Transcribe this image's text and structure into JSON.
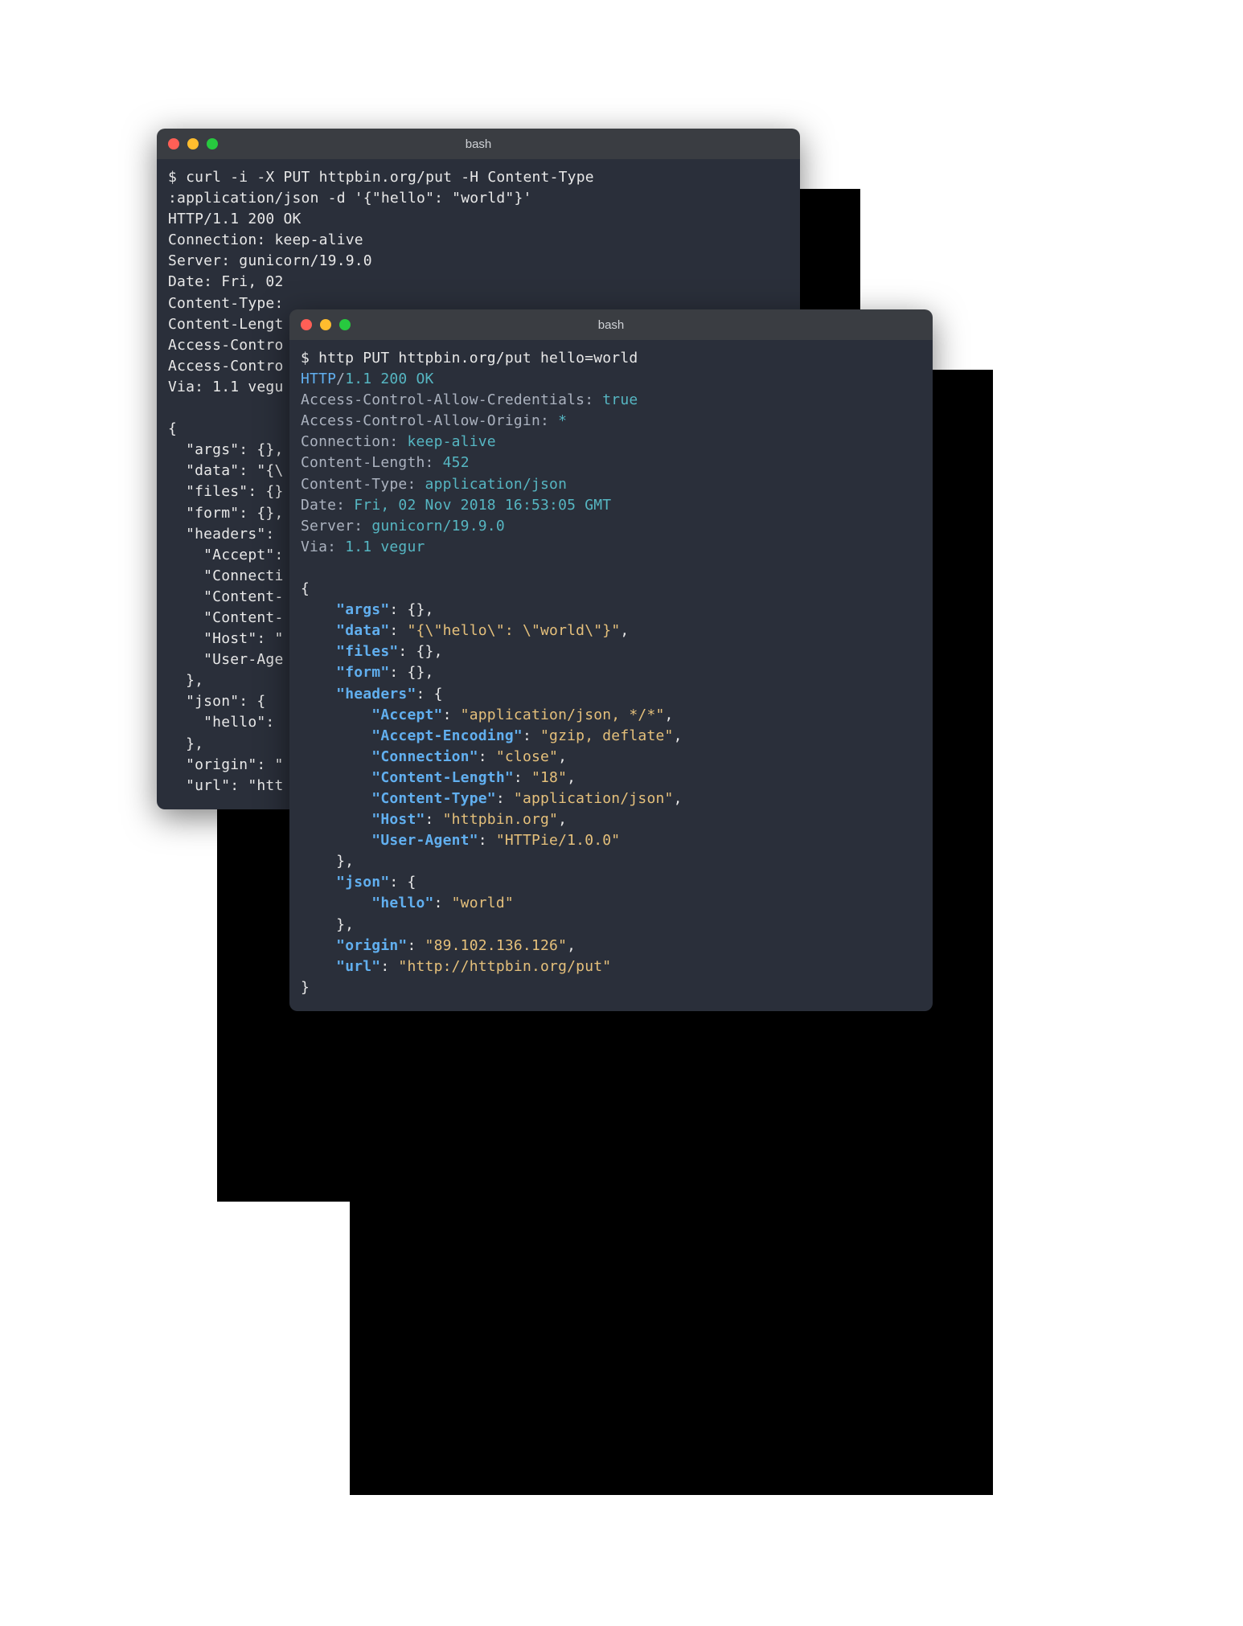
{
  "terminal1": {
    "title": "bash",
    "lines": [
      [
        {
          "t": "$ curl -i -X PUT httpbin.org/put -H Content-Type",
          "c": "c-white"
        }
      ],
      [
        {
          "t": ":application/json -d '{\"hello\": \"world\"}'",
          "c": "c-white"
        }
      ],
      [
        {
          "t": "HTTP/1.1 200 OK",
          "c": "c-white"
        }
      ],
      [
        {
          "t": "Connection: keep-alive",
          "c": "c-white"
        }
      ],
      [
        {
          "t": "Server: gunicorn/19.9.0",
          "c": "c-white"
        }
      ],
      [
        {
          "t": "Date: Fri, 02 ",
          "c": "c-white"
        }
      ],
      [
        {
          "t": "Content-Type: ",
          "c": "c-white"
        }
      ],
      [
        {
          "t": "Content-Lengt",
          "c": "c-white"
        }
      ],
      [
        {
          "t": "Access-Contro",
          "c": "c-white"
        }
      ],
      [
        {
          "t": "Access-Contro",
          "c": "c-white"
        }
      ],
      [
        {
          "t": "Via: 1.1 vegu",
          "c": "c-white"
        }
      ],
      [
        {
          "t": "",
          "c": "c-white"
        }
      ],
      [
        {
          "t": "{",
          "c": "c-white"
        }
      ],
      [
        {
          "t": "  \"args\": {},",
          "c": "c-white"
        }
      ],
      [
        {
          "t": "  \"data\": \"{\\",
          "c": "c-white"
        }
      ],
      [
        {
          "t": "  \"files\": {}",
          "c": "c-white"
        }
      ],
      [
        {
          "t": "  \"form\": {},",
          "c": "c-white"
        }
      ],
      [
        {
          "t": "  \"headers\": ",
          "c": "c-white"
        }
      ],
      [
        {
          "t": "    \"Accept\":",
          "c": "c-white"
        }
      ],
      [
        {
          "t": "    \"Connecti",
          "c": "c-white"
        }
      ],
      [
        {
          "t": "    \"Content-",
          "c": "c-white"
        }
      ],
      [
        {
          "t": "    \"Content-",
          "c": "c-white"
        }
      ],
      [
        {
          "t": "    \"Host\": \"",
          "c": "c-white"
        }
      ],
      [
        {
          "t": "    \"User-Age",
          "c": "c-white"
        }
      ],
      [
        {
          "t": "  },",
          "c": "c-white"
        }
      ],
      [
        {
          "t": "  \"json\": {",
          "c": "c-white"
        }
      ],
      [
        {
          "t": "    \"hello\": ",
          "c": "c-white"
        }
      ],
      [
        {
          "t": "  },",
          "c": "c-white"
        }
      ],
      [
        {
          "t": "  \"origin\": \"",
          "c": "c-white"
        }
      ],
      [
        {
          "t": "  \"url\": \"htt",
          "c": "c-white"
        }
      ]
    ]
  },
  "terminal2": {
    "title": "bash",
    "lines": [
      [
        {
          "t": "$ http PUT httpbin.org/put hello=world",
          "c": "c-white"
        }
      ],
      [
        {
          "t": "HTTP",
          "c": "c-blue"
        },
        {
          "t": "/",
          "c": "c-gray"
        },
        {
          "t": "1.1 200 OK",
          "c": "c-cyan"
        }
      ],
      [
        {
          "t": "Access-Control-Allow-Credentials",
          "c": "c-gray"
        },
        {
          "t": ":",
          "c": "c-gray"
        },
        {
          "t": " true",
          "c": "c-cyan"
        }
      ],
      [
        {
          "t": "Access-Control-Allow-Origin",
          "c": "c-gray"
        },
        {
          "t": ":",
          "c": "c-gray"
        },
        {
          "t": " *",
          "c": "c-cyan"
        }
      ],
      [
        {
          "t": "Connection",
          "c": "c-gray"
        },
        {
          "t": ":",
          "c": "c-gray"
        },
        {
          "t": " keep-alive",
          "c": "c-cyan"
        }
      ],
      [
        {
          "t": "Content-Length",
          "c": "c-gray"
        },
        {
          "t": ":",
          "c": "c-gray"
        },
        {
          "t": " 452",
          "c": "c-cyan"
        }
      ],
      [
        {
          "t": "Content-Type",
          "c": "c-gray"
        },
        {
          "t": ":",
          "c": "c-gray"
        },
        {
          "t": " application/json",
          "c": "c-cyan"
        }
      ],
      [
        {
          "t": "Date",
          "c": "c-gray"
        },
        {
          "t": ":",
          "c": "c-gray"
        },
        {
          "t": " Fri, 02 Nov 2018 16:53:05 GMT",
          "c": "c-cyan"
        }
      ],
      [
        {
          "t": "Server",
          "c": "c-gray"
        },
        {
          "t": ":",
          "c": "c-gray"
        },
        {
          "t": " gunicorn/19.9.0",
          "c": "c-cyan"
        }
      ],
      [
        {
          "t": "Via",
          "c": "c-gray"
        },
        {
          "t": ":",
          "c": "c-gray"
        },
        {
          "t": " 1.1 vegur",
          "c": "c-cyan"
        }
      ],
      [
        {
          "t": "",
          "c": "c-white"
        }
      ],
      [
        {
          "t": "{",
          "c": "c-white"
        }
      ],
      [
        {
          "t": "    ",
          "c": "c-white"
        },
        {
          "t": "\"args\"",
          "c": "c-blue bold"
        },
        {
          "t": ": ",
          "c": "c-white"
        },
        {
          "t": "{}",
          "c": "c-white"
        },
        {
          "t": ",",
          "c": "c-white"
        }
      ],
      [
        {
          "t": "    ",
          "c": "c-white"
        },
        {
          "t": "\"data\"",
          "c": "c-blue bold"
        },
        {
          "t": ": ",
          "c": "c-white"
        },
        {
          "t": "\"{\\\"hello\\\": \\\"world\\\"}\"",
          "c": "c-yellow"
        },
        {
          "t": ",",
          "c": "c-white"
        }
      ],
      [
        {
          "t": "    ",
          "c": "c-white"
        },
        {
          "t": "\"files\"",
          "c": "c-blue bold"
        },
        {
          "t": ": ",
          "c": "c-white"
        },
        {
          "t": "{}",
          "c": "c-white"
        },
        {
          "t": ",",
          "c": "c-white"
        }
      ],
      [
        {
          "t": "    ",
          "c": "c-white"
        },
        {
          "t": "\"form\"",
          "c": "c-blue bold"
        },
        {
          "t": ": ",
          "c": "c-white"
        },
        {
          "t": "{}",
          "c": "c-white"
        },
        {
          "t": ",",
          "c": "c-white"
        }
      ],
      [
        {
          "t": "    ",
          "c": "c-white"
        },
        {
          "t": "\"headers\"",
          "c": "c-blue bold"
        },
        {
          "t": ": {",
          "c": "c-white"
        }
      ],
      [
        {
          "t": "        ",
          "c": "c-white"
        },
        {
          "t": "\"Accept\"",
          "c": "c-blue bold"
        },
        {
          "t": ": ",
          "c": "c-white"
        },
        {
          "t": "\"application/json, */*\"",
          "c": "c-yellow"
        },
        {
          "t": ",",
          "c": "c-white"
        }
      ],
      [
        {
          "t": "        ",
          "c": "c-white"
        },
        {
          "t": "\"Accept-Encoding\"",
          "c": "c-blue bold"
        },
        {
          "t": ": ",
          "c": "c-white"
        },
        {
          "t": "\"gzip, deflate\"",
          "c": "c-yellow"
        },
        {
          "t": ",",
          "c": "c-white"
        }
      ],
      [
        {
          "t": "        ",
          "c": "c-white"
        },
        {
          "t": "\"Connection\"",
          "c": "c-blue bold"
        },
        {
          "t": ": ",
          "c": "c-white"
        },
        {
          "t": "\"close\"",
          "c": "c-yellow"
        },
        {
          "t": ",",
          "c": "c-white"
        }
      ],
      [
        {
          "t": "        ",
          "c": "c-white"
        },
        {
          "t": "\"Content-Length\"",
          "c": "c-blue bold"
        },
        {
          "t": ": ",
          "c": "c-white"
        },
        {
          "t": "\"18\"",
          "c": "c-yellow"
        },
        {
          "t": ",",
          "c": "c-white"
        }
      ],
      [
        {
          "t": "        ",
          "c": "c-white"
        },
        {
          "t": "\"Content-Type\"",
          "c": "c-blue bold"
        },
        {
          "t": ": ",
          "c": "c-white"
        },
        {
          "t": "\"application/json\"",
          "c": "c-yellow"
        },
        {
          "t": ",",
          "c": "c-white"
        }
      ],
      [
        {
          "t": "        ",
          "c": "c-white"
        },
        {
          "t": "\"Host\"",
          "c": "c-blue bold"
        },
        {
          "t": ": ",
          "c": "c-white"
        },
        {
          "t": "\"httpbin.org\"",
          "c": "c-yellow"
        },
        {
          "t": ",",
          "c": "c-white"
        }
      ],
      [
        {
          "t": "        ",
          "c": "c-white"
        },
        {
          "t": "\"User-Agent\"",
          "c": "c-blue bold"
        },
        {
          "t": ": ",
          "c": "c-white"
        },
        {
          "t": "\"HTTPie/1.0.0\"",
          "c": "c-yellow"
        }
      ],
      [
        {
          "t": "    },",
          "c": "c-white"
        }
      ],
      [
        {
          "t": "    ",
          "c": "c-white"
        },
        {
          "t": "\"json\"",
          "c": "c-blue bold"
        },
        {
          "t": ": {",
          "c": "c-white"
        }
      ],
      [
        {
          "t": "        ",
          "c": "c-white"
        },
        {
          "t": "\"hello\"",
          "c": "c-blue bold"
        },
        {
          "t": ": ",
          "c": "c-white"
        },
        {
          "t": "\"world\"",
          "c": "c-yellow"
        }
      ],
      [
        {
          "t": "    },",
          "c": "c-white"
        }
      ],
      [
        {
          "t": "    ",
          "c": "c-white"
        },
        {
          "t": "\"origin\"",
          "c": "c-blue bold"
        },
        {
          "t": ": ",
          "c": "c-white"
        },
        {
          "t": "\"89.102.136.126\"",
          "c": "c-yellow"
        },
        {
          "t": ",",
          "c": "c-white"
        }
      ],
      [
        {
          "t": "    ",
          "c": "c-white"
        },
        {
          "t": "\"url\"",
          "c": "c-blue bold"
        },
        {
          "t": ": ",
          "c": "c-white"
        },
        {
          "t": "\"http://httpbin.org/put\"",
          "c": "c-yellow"
        }
      ],
      [
        {
          "t": "}",
          "c": "c-white"
        }
      ]
    ]
  }
}
